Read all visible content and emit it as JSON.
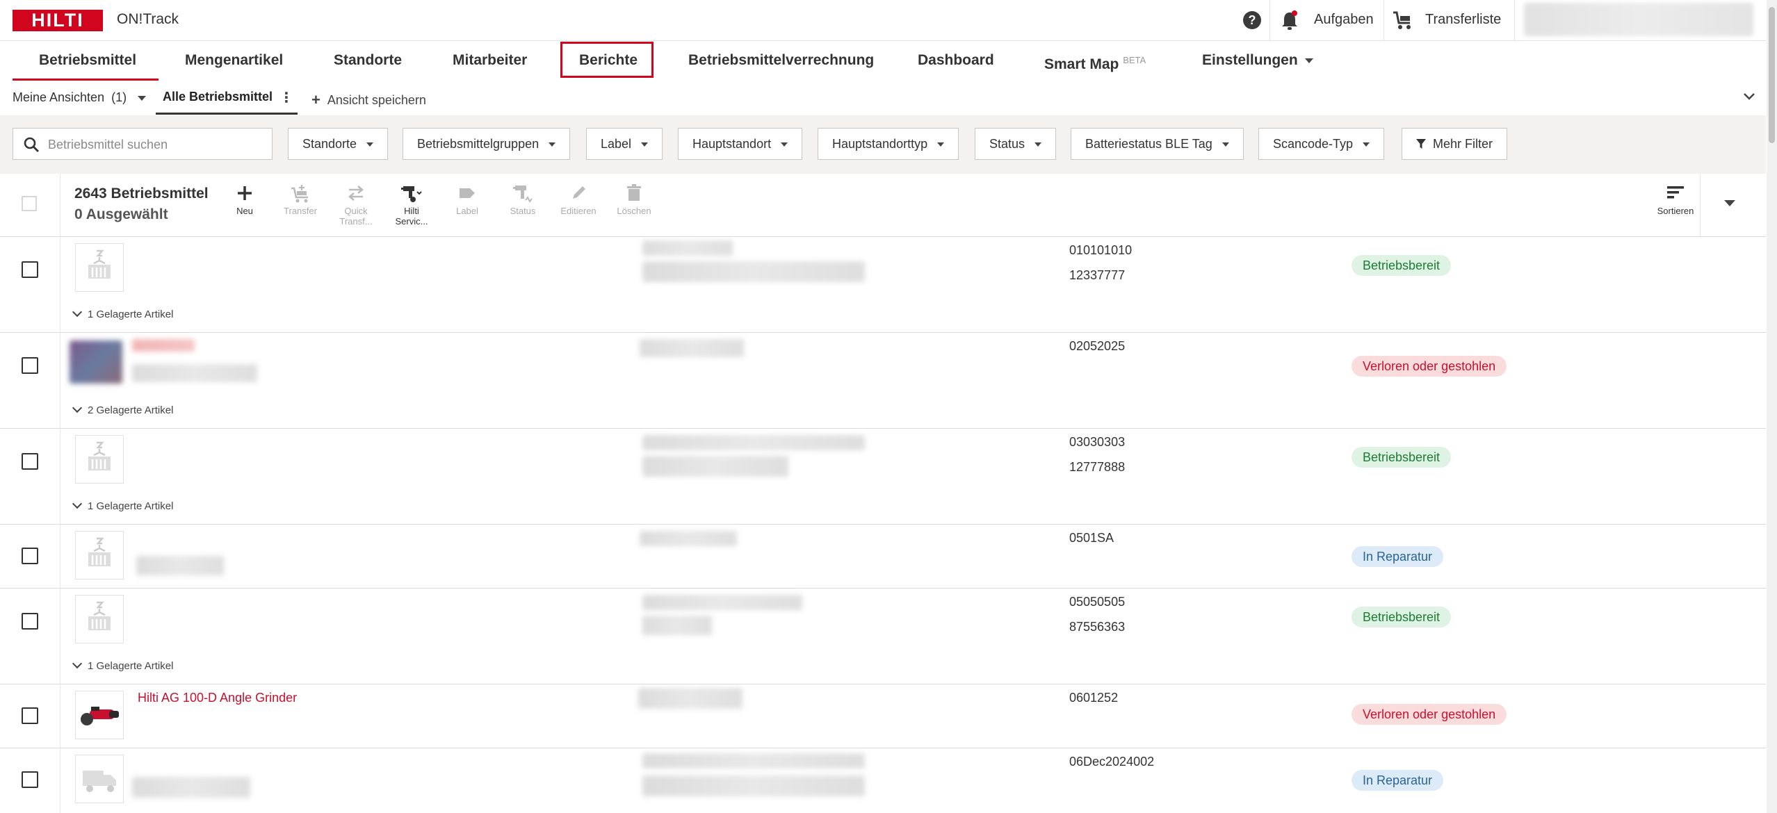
{
  "header": {
    "logo_text": "HILTI",
    "app_title": "ON!Track",
    "help_label": "?",
    "tasks_label": "Aufgaben",
    "transfer_label": "Transferliste"
  },
  "nav": {
    "items": [
      {
        "label": "Betriebsmittel"
      },
      {
        "label": "Mengenartikel"
      },
      {
        "label": "Standorte"
      },
      {
        "label": "Mitarbeiter"
      },
      {
        "label": "Berichte"
      },
      {
        "label": "Betriebsmittelverrechnung"
      },
      {
        "label": "Dashboard"
      },
      {
        "label": "Smart Map",
        "badge": "BETA"
      },
      {
        "label": "Einstellungen"
      }
    ],
    "active": "Betriebsmittel",
    "highlighted": "Berichte"
  },
  "views": {
    "my_views": "Meine Ansichten  (1)",
    "current_view": "Alle Betriebsmittel",
    "save_view": "Ansicht speichern",
    "kebab": "⋮"
  },
  "filters": {
    "search_placeholder": "Betriebsmittel suchen",
    "buttons": [
      {
        "label": "Standorte"
      },
      {
        "label": "Betriebsmittelgruppen"
      },
      {
        "label": "Label"
      },
      {
        "label": "Hauptstandort"
      },
      {
        "label": "Hauptstandorttyp"
      },
      {
        "label": "Status"
      },
      {
        "label": "Batteriestatus BLE Tag"
      },
      {
        "label": "Scancode-Typ"
      }
    ],
    "more_filters": "Mehr Filter"
  },
  "toolbar": {
    "count": "2643 Betriebsmittel",
    "selected": "0 Ausgewählt",
    "tools": [
      {
        "label": "Neu"
      },
      {
        "label": "Transfer"
      },
      {
        "label": "Quick Transf..."
      },
      {
        "label": "Hilti Servic..."
      },
      {
        "label": "Label"
      },
      {
        "label": "Status"
      },
      {
        "label": "Editieren"
      },
      {
        "label": "Löschen"
      }
    ],
    "sort_label": "Sortieren"
  },
  "colors": {
    "brand": "#d2051e",
    "status_ready_bg": "#dff3e4",
    "status_ready_text": "#1e7b34",
    "status_lost_bg": "#fbdcdc",
    "status_lost_text": "#c8102e",
    "status_repair_bg": "#dcebf7",
    "status_repair_text": "#2a6496"
  },
  "rows": [
    {
      "scan1": "010101010",
      "scan2": "12337777",
      "status": "Betriebsbereit",
      "sub": "1 Gelagerte Artikel"
    },
    {
      "scan1": "02052025",
      "scan2": "",
      "status": "Verloren oder gestohlen",
      "sub": "2 Gelagerte Artikel"
    },
    {
      "scan1": "03030303",
      "scan2": "12777888",
      "status": "Betriebsbereit",
      "sub": "1 Gelagerte Artikel"
    },
    {
      "scan1": "0501SA",
      "scan2": "",
      "status": "In Reparatur",
      "sub": ""
    },
    {
      "scan1": "05050505",
      "scan2": "87556363",
      "status": "Betriebsbereit",
      "sub": "1 Gelagerte Artikel"
    },
    {
      "scan1": "0601252",
      "scan2": "",
      "status": "Verloren oder gestohlen",
      "sub": "",
      "name": "Hilti AG 100-D Angle Grinder"
    },
    {
      "scan1": "06Dec2024002",
      "scan2": "",
      "status": "In Reparatur",
      "sub": ""
    }
  ]
}
